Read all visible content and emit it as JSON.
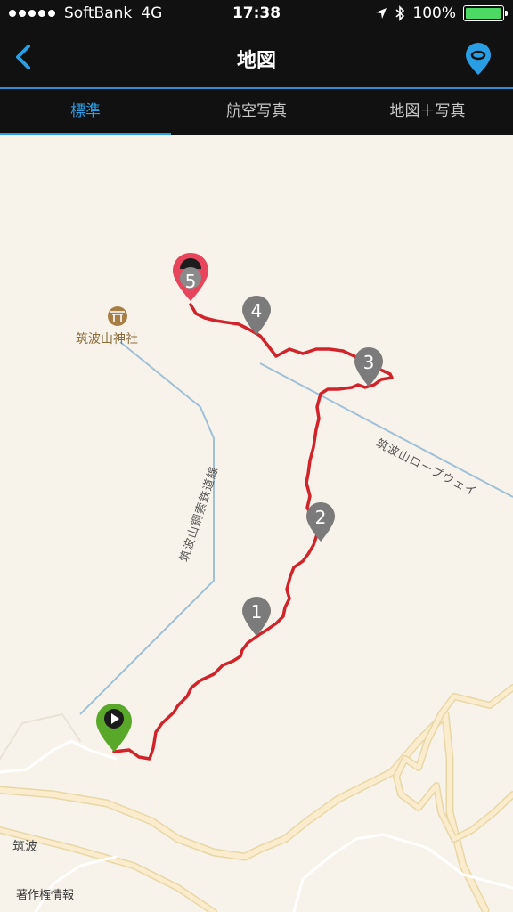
{
  "status_bar": {
    "carrier": "SoftBank",
    "network": "4G",
    "time": "17:38",
    "battery": "100%",
    "battery_level": 1.0
  },
  "navbar": {
    "title": "地図",
    "back_icon": "chevron-left-icon",
    "right_icon": "map-pin-icon"
  },
  "tabs": [
    {
      "label": "標準",
      "active": true
    },
    {
      "label": "航空写真",
      "active": false
    },
    {
      "label": "地図＋写真",
      "active": false
    }
  ],
  "map": {
    "labels": {
      "shrine": "筑波山神社",
      "ropeway": "筑波山ロープウェイ",
      "railway": "筑波山鋼索鉄道線",
      "area": "筑波",
      "copyright": "著作権情報"
    },
    "waypoints": [
      "1",
      "2",
      "3",
      "4",
      "5"
    ],
    "colors": {
      "track": "#d1232a",
      "waypoint": "#7b7b7b",
      "start": "#5aa829",
      "end": "#e8455c"
    }
  }
}
